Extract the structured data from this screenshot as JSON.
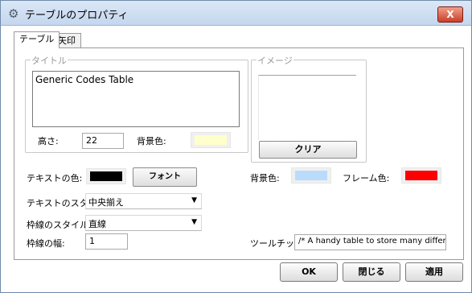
{
  "window": {
    "title": "テーブルのプロパティ",
    "close_label": "X"
  },
  "tabs": [
    {
      "label": "テーブル"
    },
    {
      "label": "矢印"
    }
  ],
  "title_group": {
    "label": "タイトル",
    "text": "Generic Codes Table"
  },
  "height": {
    "label": "高さ:",
    "value": "22"
  },
  "title_bg": {
    "label": "背景色:",
    "color": "#ffffcc"
  },
  "image_group": {
    "label": "イメージ",
    "clear_label": "クリア"
  },
  "text_color": {
    "label": "テキストの色:",
    "color": "#000000",
    "font_button": "フォント"
  },
  "right_colors": {
    "bg_label": "背景色:",
    "bg_color": "#b9dcfc",
    "frame_label": "フレーム色:",
    "frame_color": "#ff0000"
  },
  "text_style": {
    "label": "テキストのスタイル:",
    "value": "中央揃え"
  },
  "border_style": {
    "label": "枠線のスタイル:",
    "value": "直線"
  },
  "border_width": {
    "label": "枠線の幅:",
    "value": "1"
  },
  "tooltip": {
    "label": "ツールチップ:",
    "value": "/* A handy table to store many differe"
  },
  "footer": {
    "ok": "OK",
    "close": "閉じる",
    "apply": "適用"
  }
}
